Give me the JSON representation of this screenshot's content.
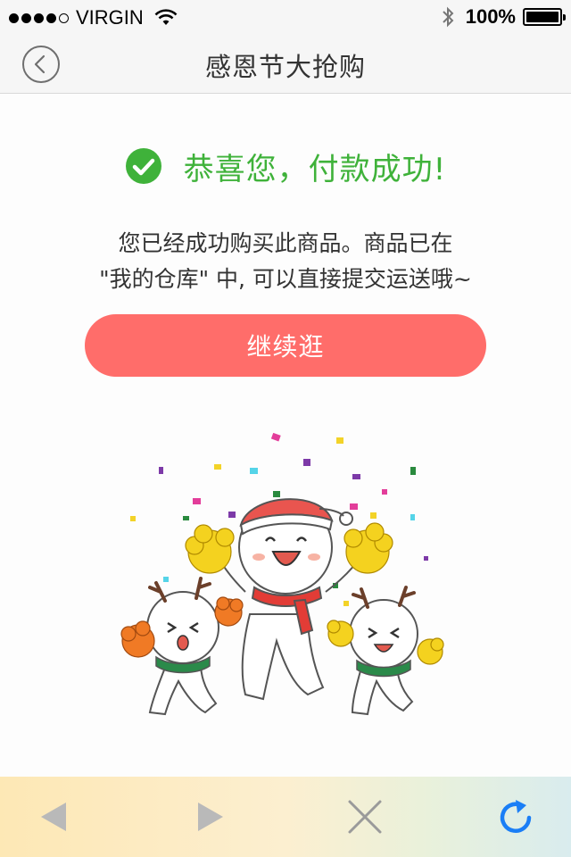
{
  "status_bar": {
    "carrier": "VIRGIN",
    "battery_text": "100%",
    "battery_level": 1.0,
    "signal_dots_filled": 4,
    "signal_dots_total": 5
  },
  "nav": {
    "title": "感恩节大抢购",
    "back_icon": "chevron-left-circle-icon"
  },
  "result": {
    "success_text": "恭喜您，付款成功!",
    "success_icon": "check-circle-icon",
    "description_line1": "您已经成功购买此商品。商品已在",
    "description_line2": "\"我的仓库\" 中, 可以直接提交运送哦~"
  },
  "actions": {
    "continue_label": "继续逛"
  },
  "toolbar": {
    "icons": [
      "back-arrow-icon",
      "forward-arrow-icon",
      "close-icon",
      "refresh-icon"
    ]
  },
  "colors": {
    "success_green": "#3fb23a",
    "button_red": "#ff6d6a",
    "refresh_blue": "#1a7ef6",
    "disabled_gray": "#b9b9b9"
  }
}
